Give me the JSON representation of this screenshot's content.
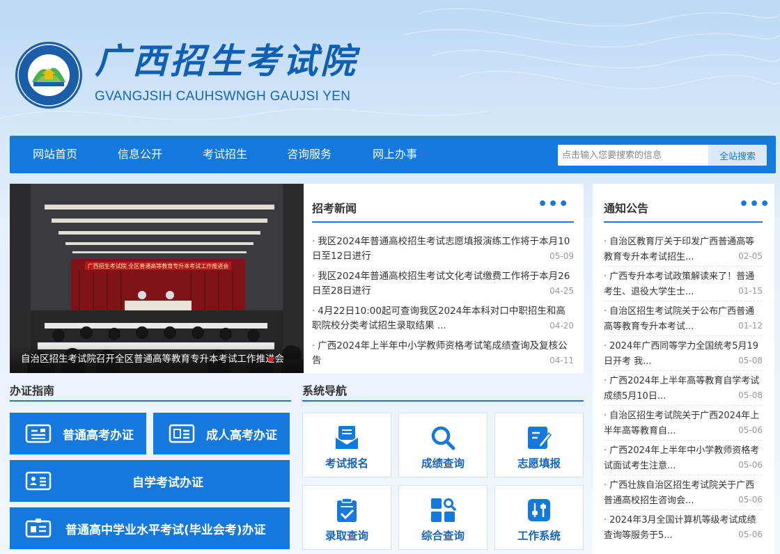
{
  "header": {
    "title": "广西招生考试院",
    "subtitle": "GVANGJSIH CAUHSWNGH GAUJSI YEN",
    "logo_ring_text": "广西招生考试院",
    "logo_ring_sub": "GVANGJSIH CAUHSWNGH GAUJSI YEN"
  },
  "nav": {
    "items": [
      {
        "label": "网站首页"
      },
      {
        "label": "信息公开"
      },
      {
        "label": "考试招生"
      },
      {
        "label": "咨询服务"
      },
      {
        "label": "网上办事"
      }
    ],
    "search": {
      "placeholder": "点击输入您要搜索的信息",
      "button": "全站搜索"
    }
  },
  "slideshow": {
    "caption": "自治区招生考试院召开全区普通高等教育专升本考试工作推进会",
    "banner_text": "广西招生考试院 全区普通高等教育专升本考试工作推进会"
  },
  "news": {
    "title": "招考新闻",
    "more": "•••",
    "items": [
      {
        "text": "我区2024年普通高校招生考试志愿填报演练工作将于本月10日至12日进行",
        "date": "05-09"
      },
      {
        "text": "我区2024年普通高校招生考试文化考试缴费工作将于本月26日至28日进行",
        "date": "04-25"
      },
      {
        "text": "4月22日10:00起可查询我区2024年本科对口中职招生和高职院校分类考试招生录取结果 ...",
        "date": "04-20"
      },
      {
        "text": "广西2024年上半年中小学教师资格考试笔成绩查询及复核公告",
        "date": "04-11"
      }
    ]
  },
  "notices": {
    "title": "通知公告",
    "more": "•••",
    "items": [
      {
        "text": "自治区教育厅关于印发广西普通高等教育专升本考试招生...",
        "date": "02-05"
      },
      {
        "text": "广西专升本考试政策解读来了！普通考生、退役大学生士...",
        "date": "01-15"
      },
      {
        "text": "自治区招生考试院关于公布广西普通高等教育专升本考试...",
        "date": "01-12"
      },
      {
        "text": "2024年广西同等学力全国统考5月19日开考 我...",
        "date": "05-08"
      },
      {
        "text": "广西2024年上半年高等教育自学考试成绩5月10日...",
        "date": "05-08"
      },
      {
        "text": "自治区招生考试院关于广西2024年上半年高等教育自...",
        "date": "05-06"
      },
      {
        "text": "广西2024年上半年中小学教师资格考试面试考生注意...",
        "date": "05-06"
      },
      {
        "text": "广西壮族自治区招生考试院关于广西普通高校招生咨询会...",
        "date": "05-06"
      },
      {
        "text": "2024年3月全国计算机等级考试成绩查询等服务于5...",
        "date": "05-06"
      }
    ]
  },
  "guide": {
    "title": "办证指南",
    "buttons": [
      {
        "label": "普通高考办证"
      },
      {
        "label": "成人高考办证"
      },
      {
        "label": "自学考试办证"
      },
      {
        "label": "普通高中学业水平考试(毕业会考)办证"
      }
    ]
  },
  "system": {
    "title": "系统导航",
    "tiles": [
      {
        "label": "考试报名",
        "icon": "envelope-form-icon"
      },
      {
        "label": "成绩查询",
        "icon": "magnifier-icon"
      },
      {
        "label": "志愿填报",
        "icon": "edit-form-icon"
      },
      {
        "label": "录取查询",
        "icon": "clipboard-check-icon"
      },
      {
        "label": "综合查询",
        "icon": "grid-search-icon"
      },
      {
        "label": "工作系统",
        "icon": "sliders-icon"
      }
    ]
  },
  "colors": {
    "primary": "#1478dc",
    "bullet": "#c0392b"
  }
}
